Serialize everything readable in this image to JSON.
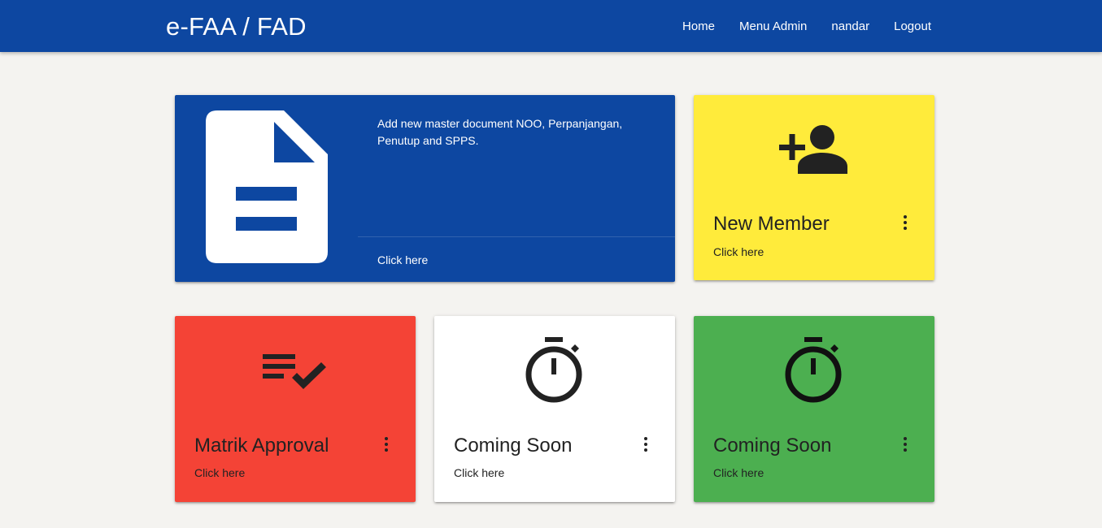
{
  "navbar": {
    "brand": "e-FAA / FAD",
    "links": [
      "Home",
      "Menu Admin",
      "nandar",
      "Logout"
    ],
    "color": "#0d47a1"
  },
  "doc_card": {
    "icon": "document-icon",
    "description": "Add new master document NOO, Perpanjangan, Penutup and SPPS.",
    "link": "Click here",
    "color": "#0d47a1"
  },
  "tiles": {
    "member": {
      "icon": "person-add-icon",
      "title": "New Member",
      "link": "Click here",
      "color": "#ffeb3b"
    },
    "matrix": {
      "icon": "playlist-check-icon",
      "title": "Matrik Approval",
      "link": "Click here",
      "color": "#f44336"
    },
    "soon1": {
      "icon": "timer-icon",
      "title": "Coming Soon",
      "link": "Click here",
      "color": "#ffffff"
    },
    "soon2": {
      "icon": "timer-icon",
      "title": "Coming Soon",
      "link": "Click here",
      "color": "#4caf50"
    }
  }
}
